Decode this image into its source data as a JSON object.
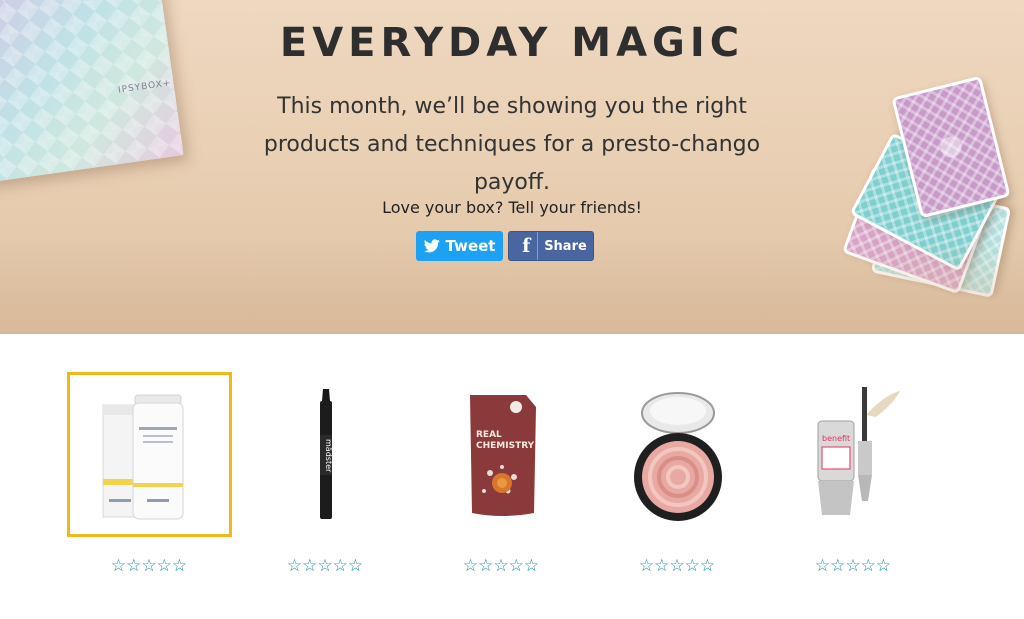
{
  "hero": {
    "title": "EVERYDAY MAGIC",
    "subtitle": "This month, we’ll be showing you the right products and techniques for a presto-chango payoff.",
    "share_prompt": "Love your box? Tell your friends!",
    "deco_box_label": "IPSYBOX+",
    "tweet_label": "Tweet",
    "share_label": "Share"
  },
  "colors": {
    "accent_selected": "#f1b81a",
    "twitter": "#1da1f2",
    "facebook": "#4a66a0",
    "star": "#1a8fa3"
  },
  "products": [
    {
      "icon": "setting-mist-bottle-icon",
      "rating": 0,
      "selected": true,
      "stars": "☆☆☆☆☆"
    },
    {
      "icon": "eyeliner-pencil-icon",
      "rating": 0,
      "selected": false,
      "stars": "☆☆☆☆☆"
    },
    {
      "icon": "mask-pouch-icon",
      "rating": 0,
      "selected": false,
      "stars": "☆☆☆☆☆"
    },
    {
      "icon": "highlighter-compact-icon",
      "rating": 0,
      "selected": false,
      "stars": "☆☆☆☆☆"
    },
    {
      "icon": "brow-gel-icon",
      "rating": 0,
      "selected": false,
      "stars": "☆☆☆☆☆"
    }
  ]
}
